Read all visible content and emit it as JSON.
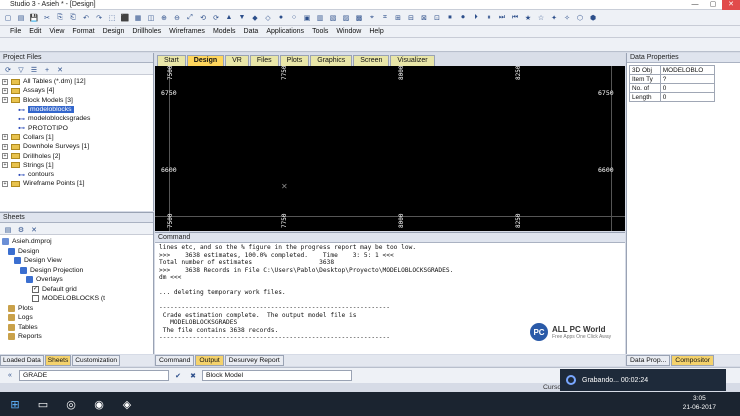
{
  "window": {
    "title": "Studio 3 - Asieh * - [Design]"
  },
  "menu": [
    "File",
    "Edit",
    "View",
    "Format",
    "Design",
    "Drillholes",
    "Wireframes",
    "Models",
    "Data",
    "Applications",
    "Tools",
    "Window",
    "Help"
  ],
  "project_files": {
    "title": "Project Files",
    "items": [
      {
        "label": "All Tables (*.dm) [12]",
        "type": "folder"
      },
      {
        "label": "Assays [4]",
        "type": "folder"
      },
      {
        "label": "Block Models [3]",
        "type": "folder"
      },
      {
        "label": "modeloblocks",
        "type": "model",
        "selected": true
      },
      {
        "label": "modeloblocksgrades",
        "type": "model"
      },
      {
        "label": "PROTOTIPO",
        "type": "model"
      },
      {
        "label": "Collars [1]",
        "type": "folder"
      },
      {
        "label": "Downhole Surveys [1]",
        "type": "folder"
      },
      {
        "label": "Drillholes [2]",
        "type": "folder"
      },
      {
        "label": "Strings [1]",
        "type": "folder"
      },
      {
        "label": "contours",
        "type": "string"
      },
      {
        "label": "Wireframe Points [1]",
        "type": "folder"
      }
    ]
  },
  "sheets": {
    "title": "Sheets",
    "items": [
      {
        "label": "Asieh.dmproj"
      },
      {
        "label": "Design"
      },
      {
        "label": "Design View"
      },
      {
        "label": "Design Projection"
      },
      {
        "label": "Overlays"
      },
      {
        "label": "Default grid",
        "checked": true
      },
      {
        "label": "MODELOBLOCKS (t",
        "checked": false
      },
      {
        "label": "Plots"
      },
      {
        "label": "Logs"
      },
      {
        "label": "Tables"
      },
      {
        "label": "Reports"
      }
    ]
  },
  "left_tabs": [
    "Loaded Data",
    "Sheets",
    "Customization"
  ],
  "view_tabs": [
    "Start",
    "Design",
    "VR",
    "Files",
    "Plots",
    "Graphics",
    "Screen",
    "Visualizer"
  ],
  "viewport": {
    "y_labels": [
      "6750",
      "6600"
    ],
    "x_labels_top": [
      "7750",
      "8000",
      "8250"
    ],
    "x_labels_bottom": [
      "7750",
      "8000",
      "8250"
    ],
    "corner_labels": [
      "7500",
      "7500"
    ]
  },
  "command": {
    "title": "Command",
    "lines": [
      "lines etc, and so the % figure in the progress report may be too low.",
      ">>>    3638 estimates, 100.0% completed.    Time    3: 5: 1 <<<",
      "Total number of estimates                  3638",
      ">>>    3638 Records in File C:\\Users\\Pablo\\Desktop\\Proyecto\\MODELOBLOCKSGRADES.",
      "dm <<<",
      "",
      "... deleting temporary work files.",
      "",
      "--------------------------------------------------------------",
      " Crade estimation complete.  The output model file is",
      "   MODELOBLOCKSGRADES",
      " The file contains 3638 records.",
      "--------------------------------------------------------------"
    ]
  },
  "bottom_tabs": [
    "Command",
    "Output",
    "Desurvey Report"
  ],
  "data_properties": {
    "title": "Data Properties",
    "rows": [
      [
        "3D Obj",
        "MODELOBLO"
      ],
      [
        "Item Ty",
        "?"
      ],
      [
        "No. of",
        "0"
      ],
      [
        "Length",
        "0"
      ]
    ]
  },
  "right_tabs": [
    "Data Prop...",
    "Compositor"
  ],
  "status": {
    "field1": "GRADE",
    "field2": "Block Model",
    "cursor_label": "Curso"
  },
  "recorder": {
    "label": "Grabando... 00:02:24"
  },
  "clock": {
    "time": "3:05",
    "date": "21-06-2017"
  },
  "watermark": {
    "title": "ALL PC World",
    "subtitle": "Free Apps One Click Away"
  }
}
